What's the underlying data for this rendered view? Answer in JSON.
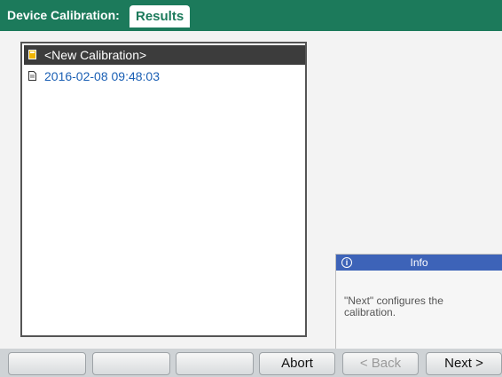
{
  "header": {
    "title": "Device Calibration:",
    "tab": "Results"
  },
  "list": {
    "items": [
      {
        "label": "<New Calibration>",
        "selected": true,
        "icon": "new-calibration-icon"
      },
      {
        "label": "2016-02-08 09:48:03",
        "selected": false,
        "icon": "document-icon"
      }
    ]
  },
  "info": {
    "title": "Info",
    "icon": "info-icon",
    "text": "\"Next\" configures the calibration."
  },
  "buttons": {
    "b1": "",
    "b2": "",
    "b3": "",
    "abort": "Abort",
    "back": "< Back",
    "next": "Next >"
  },
  "colors": {
    "titlebar": "#1c7a5b",
    "selection": "#3c3c3c",
    "link_text": "#1a5fb4",
    "info_header": "#3d63b8"
  }
}
